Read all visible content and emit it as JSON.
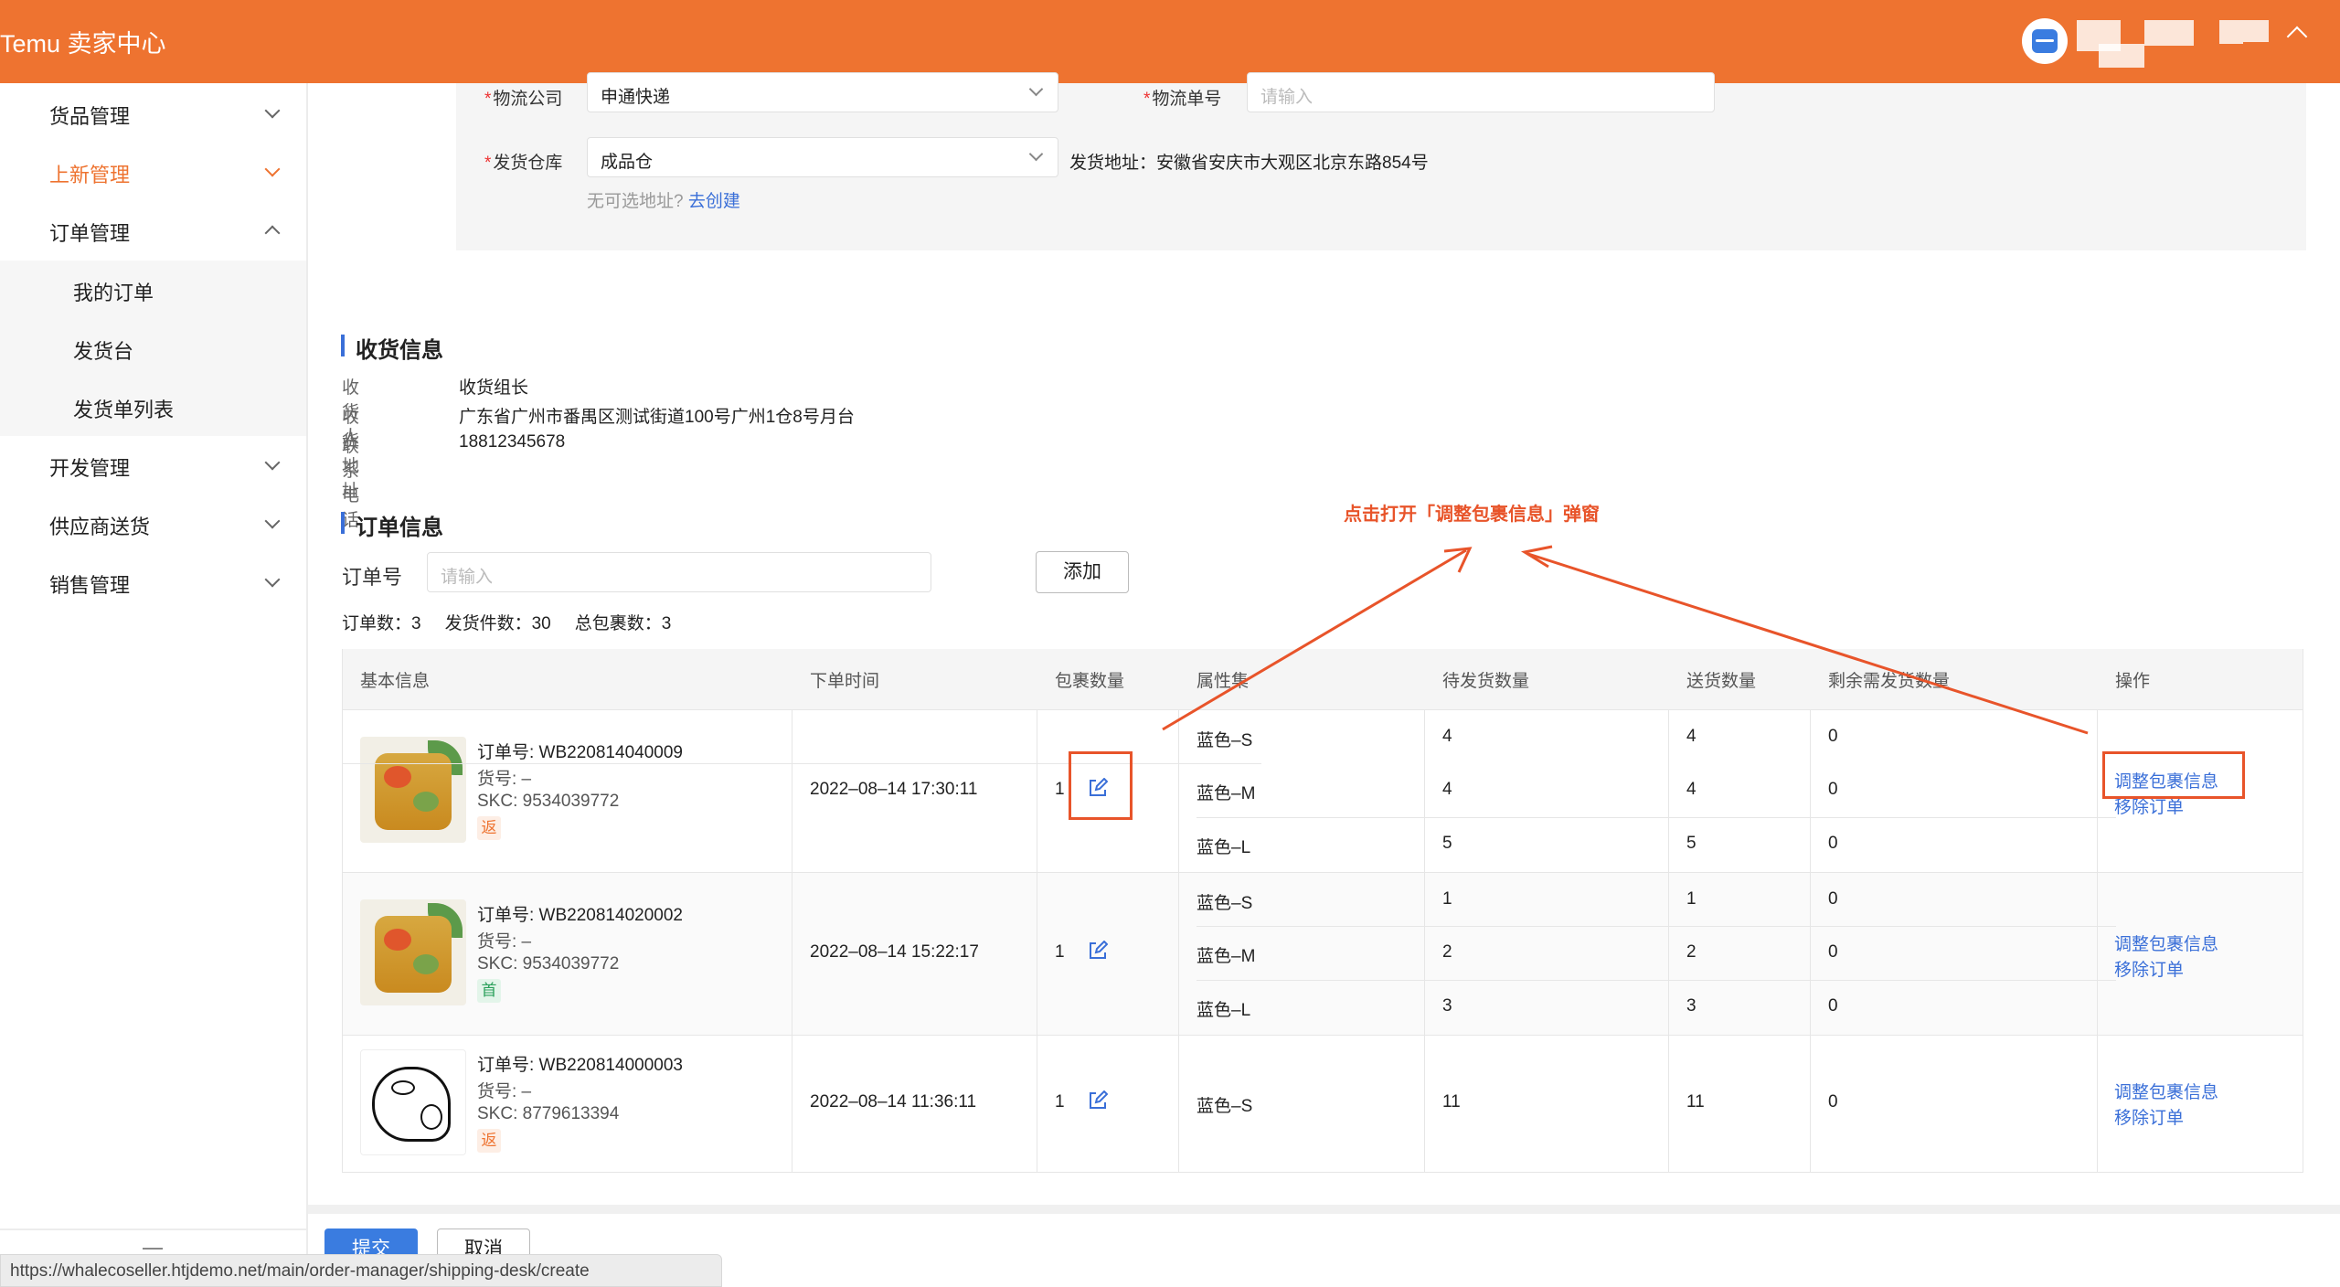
{
  "header": {
    "brand": "Temu 卖家中心"
  },
  "sidebar": {
    "items": [
      {
        "label": "货品管理"
      },
      {
        "label": "上新管理"
      },
      {
        "label": "订单管理"
      },
      {
        "label": "开发管理"
      },
      {
        "label": "供应商送货"
      },
      {
        "label": "销售管理"
      }
    ],
    "sub_items": [
      {
        "label": "我的订单"
      },
      {
        "label": "发货台"
      },
      {
        "label": "发货单列表"
      }
    ]
  },
  "logistics": {
    "company_label": "物流公司",
    "company_value": "申通快递",
    "tracking_label": "物流单号",
    "tracking_placeholder": "请输入",
    "warehouse_label": "发货仓库",
    "warehouse_value": "成品仓",
    "address_text": "发货地址：安徽省安庆市大观区北京东路854号",
    "hint_text": "无可选地址?",
    "hint_link": "去创建"
  },
  "receiver": {
    "title": "收货信息",
    "name_label": "收货人",
    "name_value": "收货组长",
    "address_label": "收货地址",
    "address_value": "广东省广州市番禺区测试街道100号广州1仓8号月台",
    "phone_label": "联系电话",
    "phone_value": "18812345678"
  },
  "orders": {
    "title": "订单信息",
    "search_label": "订单号",
    "search_placeholder": "请输入",
    "add_button": "添加",
    "stats": {
      "order_count": "订单数：3",
      "ship_count": "发货件数：30",
      "package_count": "总包裹数：3"
    },
    "columns": [
      "基本信息",
      "下单时间",
      "包裹数量",
      "属性集",
      "待发货数量",
      "送货数量",
      "剩余需发货数量",
      "操作"
    ],
    "rows": [
      {
        "order_no": "订单号: WB220814040009",
        "goods_no": "货号: –",
        "skc": "SKC: 9534039772",
        "tag": "返",
        "time": "2022–08–14 17:30:11",
        "packages": "1",
        "action_adjust": "调整包裹信息",
        "action_remove": "移除订单",
        "skus": [
          {
            "attr": "蓝色–S",
            "pending": "4",
            "deliver": "4",
            "remain": "0"
          },
          {
            "attr": "蓝色–M",
            "pending": "4",
            "deliver": "4",
            "remain": "0"
          },
          {
            "attr": "蓝色–L",
            "pending": "5",
            "deliver": "5",
            "remain": "0"
          }
        ]
      },
      {
        "order_no": "订单号: WB220814020002",
        "goods_no": "货号: –",
        "skc": "SKC: 9534039772",
        "tag": "首",
        "time": "2022–08–14 15:22:17",
        "packages": "1",
        "action_adjust": "调整包裹信息",
        "action_remove": "移除订单",
        "skus": [
          {
            "attr": "蓝色–S",
            "pending": "1",
            "deliver": "1",
            "remain": "0"
          },
          {
            "attr": "蓝色–M",
            "pending": "2",
            "deliver": "2",
            "remain": "0"
          },
          {
            "attr": "蓝色–L",
            "pending": "3",
            "deliver": "3",
            "remain": "0"
          }
        ]
      },
      {
        "order_no": "订单号: WB220814000003",
        "goods_no": "货号: –",
        "skc": "SKC: 8779613394",
        "tag": "返",
        "time": "2022–08–14 11:36:11",
        "packages": "1",
        "action_adjust": "调整包裹信息",
        "action_remove": "移除订单",
        "skus": [
          {
            "attr": "蓝色–S",
            "pending": "11",
            "deliver": "11",
            "remain": "0"
          }
        ]
      }
    ]
  },
  "annotation": {
    "text": "点击打开「调整包裹信息」弹窗",
    "color": "#e8542a"
  },
  "footer": {
    "submit": "提交",
    "cancel": "取消"
  },
  "statusbar": {
    "url": "https://whalecoseller.htjdemo.net/main/order-manager/shipping-desk/create"
  },
  "colors": {
    "brand": "#ee7330",
    "link": "#3a6fd8",
    "primary": "#3a7ce0"
  }
}
